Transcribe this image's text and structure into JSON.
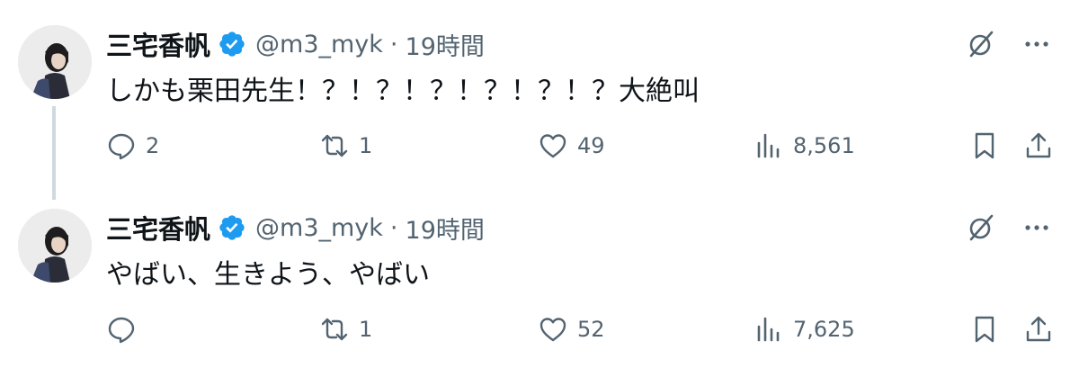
{
  "tweets": [
    {
      "author": "三宅香帆",
      "handle": "@m3_myk",
      "separator": "·",
      "time": "19時間",
      "text": "しかも栗田先生！？！？！？！？！？！？大絶叫",
      "replies": "2",
      "retweets": "1",
      "likes": "49",
      "views": "8,561"
    },
    {
      "author": "三宅香帆",
      "handle": "@m3_myk",
      "separator": "·",
      "time": "19時間",
      "text": "やばい、生きよう、やばい",
      "replies": "",
      "retweets": "1",
      "likes": "52",
      "views": "7,625"
    }
  ],
  "colors": {
    "text": "#0f1419",
    "muted": "#536471",
    "verified": "#1d9bf0",
    "thread_line": "#cfd9de"
  },
  "icons": [
    "verified-badge-icon",
    "grok-icon",
    "more-icon",
    "reply-icon",
    "retweet-icon",
    "like-icon",
    "views-icon",
    "bookmark-icon",
    "share-icon"
  ]
}
